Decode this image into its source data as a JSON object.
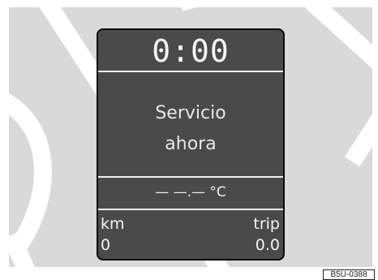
{
  "display": {
    "clock": "0:00",
    "message_line1": "Servicio",
    "message_line2": "ahora",
    "temperature": "—  —.—  °C",
    "odometer_label": "km",
    "trip_label": "trip",
    "odometer_value": "0",
    "trip_value": "0.0"
  },
  "figure_code": "B5U-0388",
  "colors": {
    "background_panel": "#d9d9d9",
    "display_background": "#4a4a4a",
    "display_border": "#0d0d0d",
    "display_text": "#f2f2f2",
    "watermark": "#ffffff"
  }
}
